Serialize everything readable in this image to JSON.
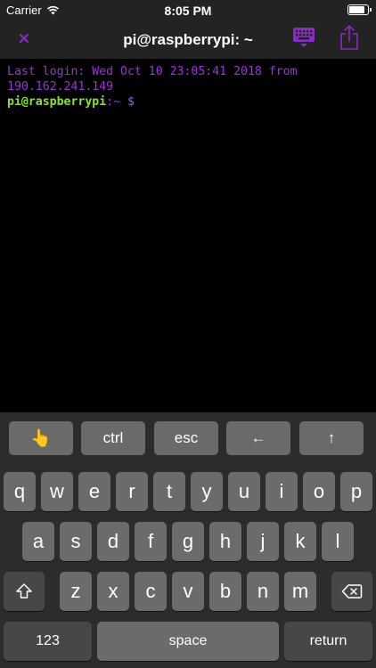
{
  "status_bar": {
    "carrier": "Carrier",
    "time": "8:05 PM",
    "battery_level": 0.85
  },
  "nav": {
    "title": "pi@raspberrypi: ~",
    "accent": "#8a2bc8"
  },
  "terminal": {
    "line1": "Last login: Wed Oct 10 23:05:41 2018 from",
    "line2": "190.162.241.149",
    "prompt_user": "pi@raspberrypi",
    "prompt_path": ":~",
    "prompt_symbol": " $"
  },
  "accessory_bar": {
    "touch_icon": "👆",
    "ctrl": "ctrl",
    "esc": "esc",
    "left_arrow": "←",
    "up_arrow": "↑"
  },
  "keyboard": {
    "row1": [
      "q",
      "w",
      "e",
      "r",
      "t",
      "y",
      "u",
      "i",
      "o",
      "p"
    ],
    "row2": [
      "a",
      "s",
      "d",
      "f",
      "g",
      "h",
      "j",
      "k",
      "l"
    ],
    "row3": [
      "z",
      "x",
      "c",
      "v",
      "b",
      "n",
      "m"
    ],
    "numbers": "123",
    "space": "space",
    "return": "return"
  }
}
